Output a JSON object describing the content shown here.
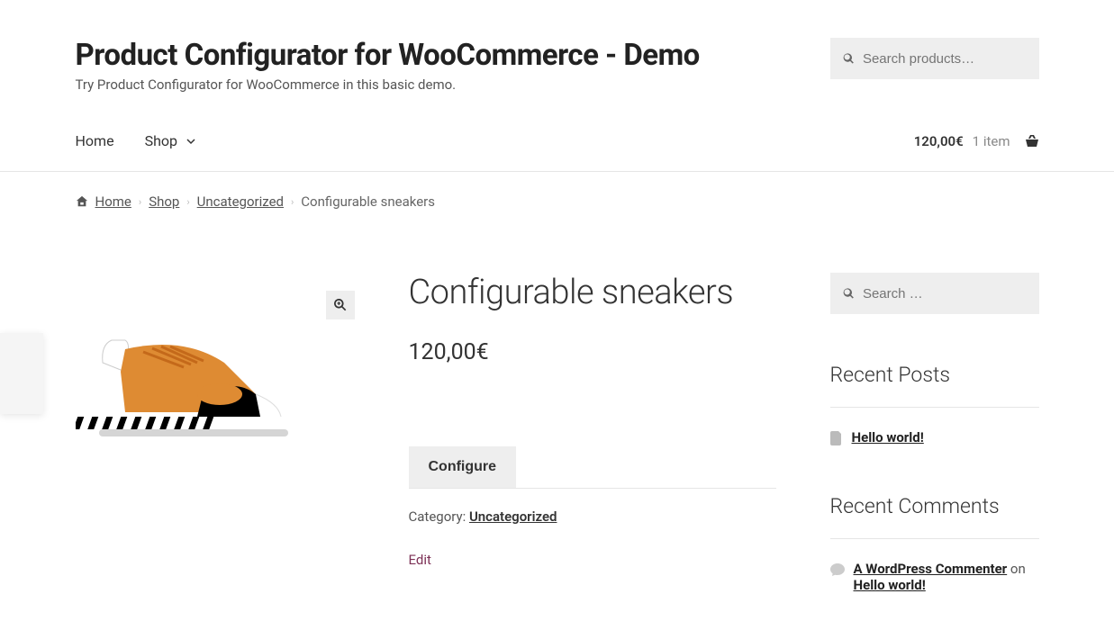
{
  "header": {
    "site_title": "Product Configurator for WooCommerce - Demo",
    "tagline": "Try Product Configurator for WooCommerce in this basic demo.",
    "search_placeholder": "Search products…"
  },
  "nav": {
    "home": "Home",
    "shop": "Shop"
  },
  "cart": {
    "total": "120,00€",
    "count": "1 item"
  },
  "breadcrumb": {
    "home": "Home",
    "shop": "Shop",
    "category": "Uncategorized",
    "current": "Configurable sneakers"
  },
  "product": {
    "title": "Configurable sneakers",
    "price": "120,00€",
    "configure_label": "Configure",
    "category_label": "Category: ",
    "category_link": "Uncategorized",
    "edit_label": "Edit"
  },
  "sidebar": {
    "search_placeholder": "Search …",
    "recent_posts_title": "Recent Posts",
    "recent_post_1": "Hello world!",
    "recent_comments_title": "Recent Comments",
    "commenter": "A WordPress Commenter",
    "on_text": " on ",
    "comment_post": "Hello world!"
  }
}
